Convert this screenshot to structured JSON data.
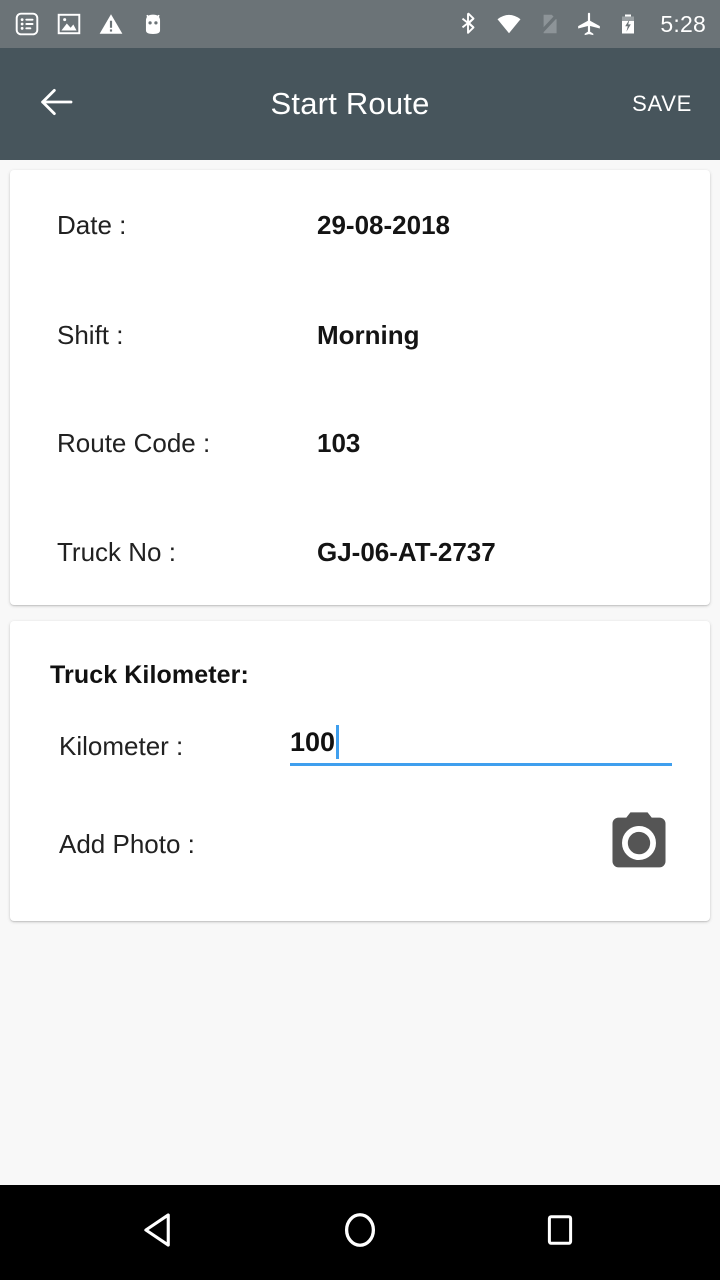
{
  "status_bar": {
    "background": "#6b7377",
    "clock": "5:28",
    "left_icons": [
      {
        "name": "notes-list-icon",
        "label": "list"
      },
      {
        "name": "image-icon",
        "label": "image"
      },
      {
        "name": "warning-triangle-icon",
        "label": "warning"
      },
      {
        "name": "android-head-icon",
        "label": "android"
      }
    ],
    "right_icons": [
      {
        "name": "bluetooth-icon",
        "label": "bluetooth"
      },
      {
        "name": "wifi-icon",
        "label": "wifi"
      },
      {
        "name": "no-sim-icon",
        "label": "no sim"
      },
      {
        "name": "airplane-mode-icon",
        "label": "airplane mode"
      },
      {
        "name": "battery-charging-icon",
        "label": "battery charging"
      }
    ]
  },
  "app_bar": {
    "background": "#47555c",
    "title": "Start Route",
    "back_label": "Back",
    "save_label": "SAVE"
  },
  "info_card": {
    "rows": [
      {
        "label": "Date :",
        "value": "29-08-2018"
      },
      {
        "label": "Shift :",
        "value": "Morning"
      },
      {
        "label": "Route Code :",
        "value": "103"
      },
      {
        "label": "Truck No :",
        "value": "GJ-06-AT-2737"
      }
    ]
  },
  "kilometer_card": {
    "section_title": "Truck Kilometer:",
    "kilometer_label": "Kilometer :",
    "kilometer_value": "100",
    "kilometer_placeholder": "",
    "accent_color": "#3f9fee",
    "photo_label": "Add Photo :",
    "camera_icon_name": "camera-icon",
    "camera_color": "#555555"
  },
  "nav_bar": {
    "background": "#000000",
    "back_label": "Back",
    "home_label": "Home",
    "recents_label": "Recents"
  }
}
